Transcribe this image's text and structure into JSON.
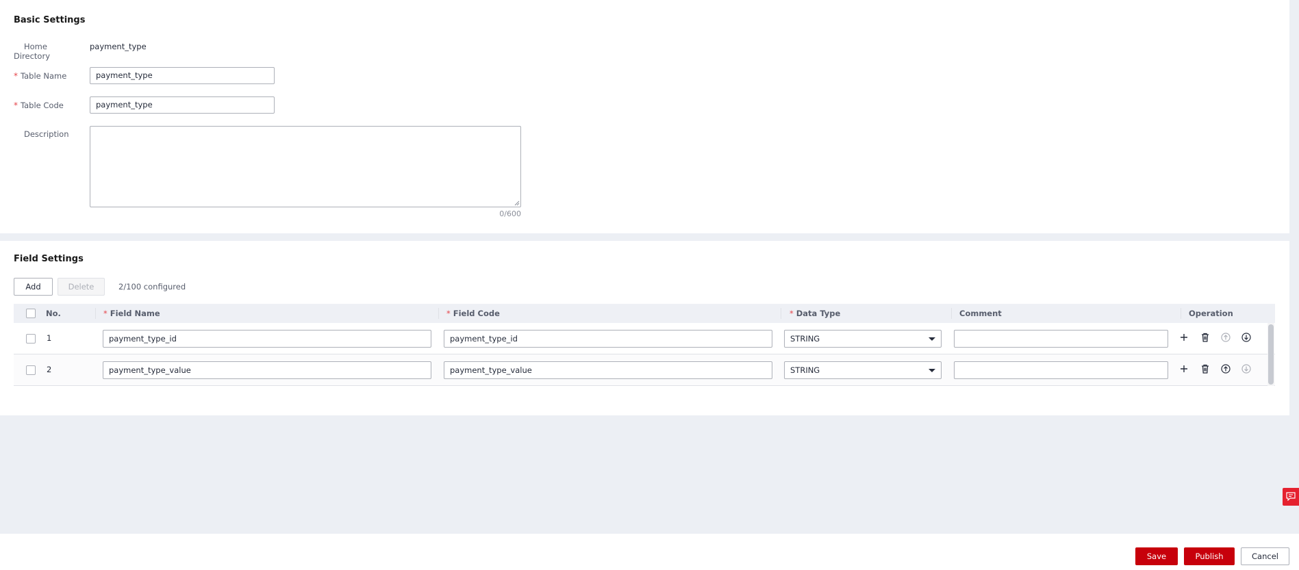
{
  "basic_settings": {
    "title": "Basic Settings",
    "home_directory": {
      "label": "Home Directory",
      "value": "payment_type"
    },
    "table_name": {
      "label": "Table Name",
      "required_mark": "*",
      "value": "payment_type"
    },
    "table_code": {
      "label": "Table Code",
      "required_mark": "*",
      "value": "payment_type"
    },
    "description": {
      "label": "Description",
      "value": "",
      "counter": "0/600"
    }
  },
  "field_settings": {
    "title": "Field Settings",
    "add_label": "Add",
    "delete_label": "Delete",
    "configured_text": "2/100 configured",
    "columns": {
      "no": "No.",
      "field_name": "Field Name",
      "field_code": "Field Code",
      "data_type": "Data Type",
      "comment": "Comment",
      "operation": "Operation",
      "required_mark": "*"
    },
    "rows": [
      {
        "no": "1",
        "field_name": "payment_type_id",
        "field_code": "payment_type_id",
        "data_type": "STRING",
        "comment": ""
      },
      {
        "no": "2",
        "field_name": "payment_type_value",
        "field_code": "payment_type_value",
        "data_type": "STRING",
        "comment": ""
      }
    ],
    "operation_icons": [
      "plus-icon",
      "trash-icon",
      "move-up-icon",
      "move-down-icon"
    ]
  },
  "footer": {
    "save_label": "Save",
    "publish_label": "Publish",
    "cancel_label": "Cancel"
  },
  "colors": {
    "primary": "#c7000b",
    "required": "#e5454b",
    "feedback": "#e5212f",
    "page_bg": "#eceff4"
  }
}
